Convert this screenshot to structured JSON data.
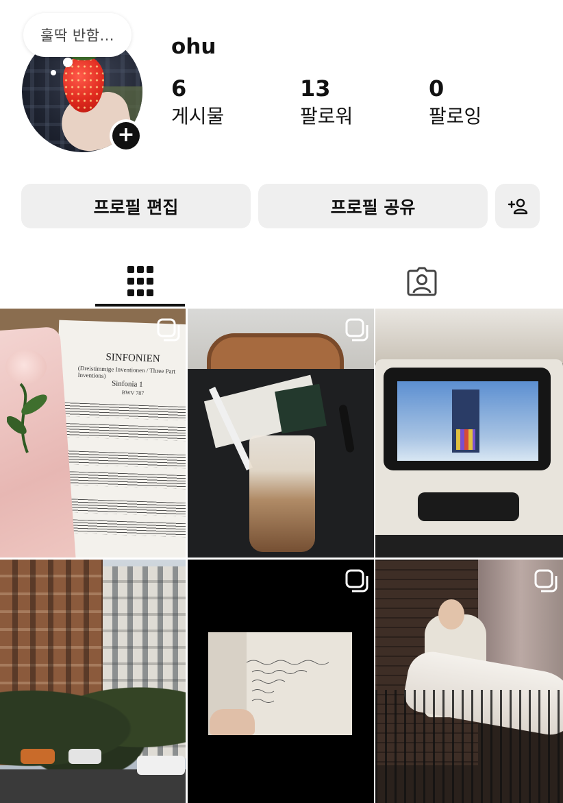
{
  "profile": {
    "note": "훌딱 반함...",
    "username": "ohu",
    "stats": [
      {
        "value": "6",
        "label": "게시물"
      },
      {
        "value": "13",
        "label": "팔로워"
      },
      {
        "value": "0",
        "label": "팔로잉"
      }
    ]
  },
  "actions": {
    "edit_label": "프로필 편집",
    "share_label": "프로필 공유",
    "add_person_icon": "add-person-icon"
  },
  "tabs": [
    {
      "name": "grid",
      "icon": "grid-icon",
      "selected": true
    },
    {
      "name": "tagged",
      "icon": "tagged-person-icon",
      "selected": false
    }
  ],
  "posts": [
    {
      "subject": "sheet music with pink rose bouquet",
      "multi": true,
      "text": {
        "title": "SINFONIEN",
        "subtitle": "(Dreistimmige Inventionen / Three Part Inventions)",
        "piece": "Sinfonia 1",
        "bwv": "BWV 787"
      }
    },
    {
      "subject": "iced latte with notebooks on table",
      "multi": true
    },
    {
      "subject": "in-flight entertainment screen",
      "multi": false
    },
    {
      "subject": "city street with buildings and trees",
      "multi": false
    },
    {
      "subject": "handwritten notebook page held in hand",
      "multi": true
    },
    {
      "subject": "man dipping woman in white dress at night",
      "multi": true
    }
  ]
}
